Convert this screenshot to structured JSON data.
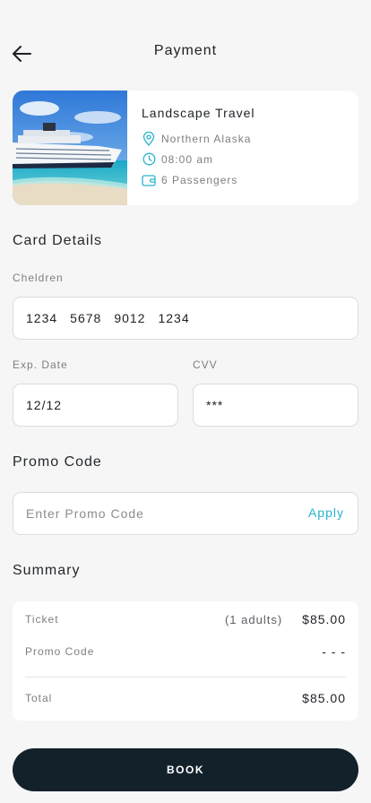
{
  "header": {
    "title": "Payment",
    "back_icon": "arrow-left-icon"
  },
  "trip": {
    "title": "Landscape Travel",
    "location": "Northern Alaska",
    "time": "08:00 am",
    "passengers": "6 Passengers",
    "icons": [
      "location-pin-icon",
      "clock-icon",
      "wallet-icon"
    ],
    "accent_color": "#27b3cf"
  },
  "card_details": {
    "title": "Card Details",
    "number_label": "Cheldren",
    "number_groups": [
      "1234",
      "5678",
      "9012",
      "1234"
    ],
    "exp_label": "Exp. Date",
    "exp_value": "12/12",
    "cvv_label": "CVV",
    "cvv_value": "***"
  },
  "promo": {
    "title": "Promo Code",
    "placeholder": "Enter Promo Code",
    "apply_label": "Apply"
  },
  "summary": {
    "title": "Summary",
    "ticket_label": "Ticket",
    "ticket_note": "(1 adults)",
    "ticket_value": "$85.00",
    "promo_label": "Promo Code",
    "promo_value": "- - -",
    "total_label": "Total",
    "total_value": "$85.00"
  },
  "book": {
    "label": "BOOK",
    "color": "#13212b"
  }
}
